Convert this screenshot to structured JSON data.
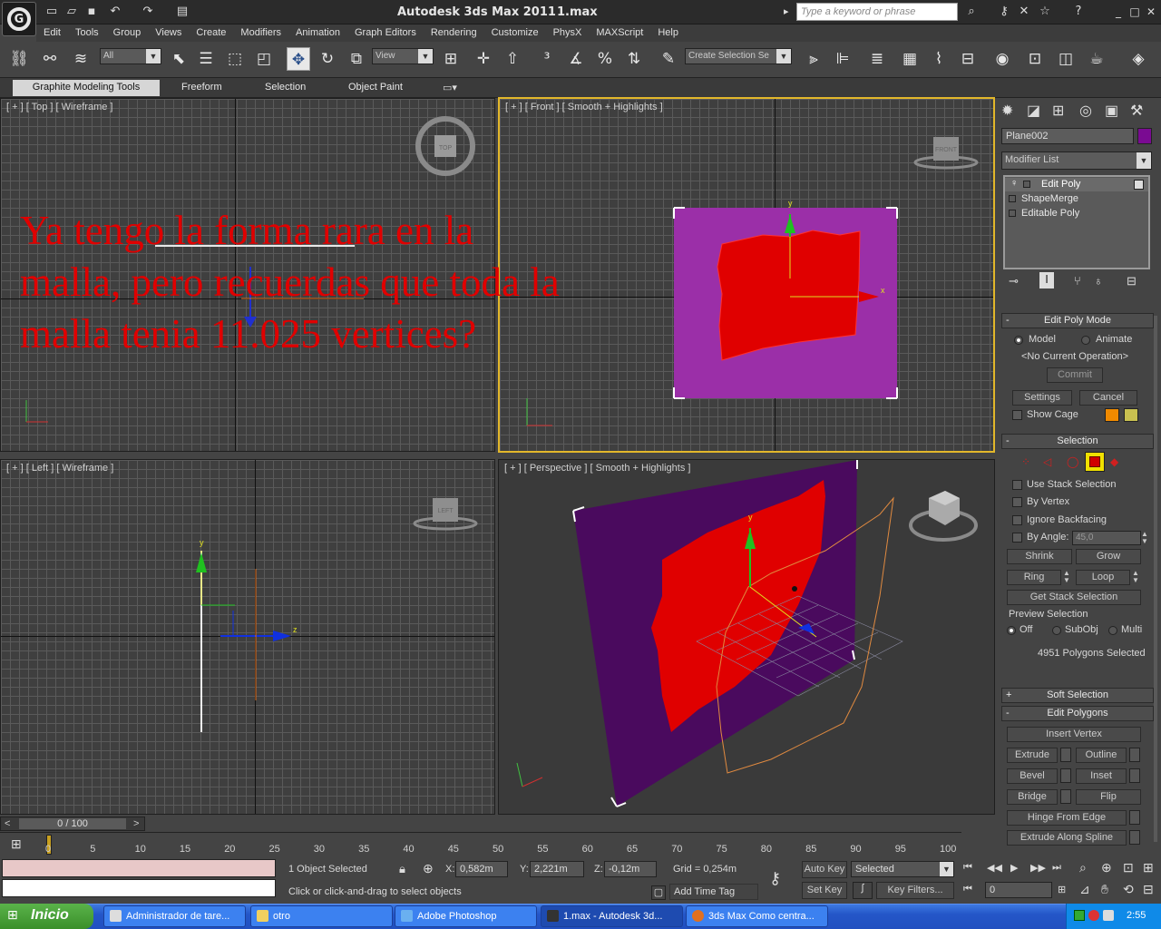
{
  "title_bar": {
    "app_title": "Autodesk 3ds Max  2011",
    "file_name": "1.max",
    "search_placeholder": "Type a keyword or phrase"
  },
  "menu": [
    "Edit",
    "Tools",
    "Group",
    "Views",
    "Create",
    "Modifiers",
    "Animation",
    "Graph Editors",
    "Rendering",
    "Customize",
    "PhysX",
    "MAXScript",
    "Help"
  ],
  "toolbar": {
    "selection_filter": "All",
    "ref_coord": "View",
    "named_selection": "Create Selection Se"
  },
  "ribbon": {
    "tabs": [
      "Graphite Modeling Tools",
      "Freeform",
      "Selection",
      "Object Paint"
    ]
  },
  "viewports": {
    "top": "[ + ] [ Top ] [ Wireframe ]",
    "front": "[ + ] [ Front ] [ Smooth + Highlights ]",
    "left": "[ + ] [ Left ] [ Wireframe ]",
    "perspective": "[ + ] [ Perspective ] [ Smooth + Highlights ]",
    "cube_top": "TOP",
    "cube_front": "FRONT",
    "cube_left": "LEFT"
  },
  "overlay_text": "Ya tengo la forma rara en la malla, pero recuerdas que toda la malla tenia 11.025 vertices?",
  "command_panel": {
    "object_name": "Plane002",
    "object_color": "#7a0b92",
    "modifier_list": "Modifier List",
    "stack": [
      "Edit Poly",
      "ShapeMerge",
      "Editable Poly"
    ],
    "edit_poly_mode": {
      "header": "Edit Poly Mode",
      "model": "Model",
      "animate": "Animate",
      "operation": "<No Current Operation>",
      "commit": "Commit",
      "settings": "Settings",
      "cancel": "Cancel",
      "show_cage": "Show Cage",
      "cage_color1": "#f08a00",
      "cage_color2": "#c8c050"
    },
    "selection": {
      "header": "Selection",
      "use_stack": "Use Stack Selection",
      "by_vertex": "By Vertex",
      "ignore_backfacing": "Ignore Backfacing",
      "by_angle": "By Angle:",
      "angle_value": "45,0",
      "shrink": "Shrink",
      "grow": "Grow",
      "ring": "Ring",
      "loop": "Loop",
      "get_stack": "Get Stack Selection",
      "preview": "Preview Selection",
      "off": "Off",
      "subobj": "SubObj",
      "multi": "Multi",
      "count": "4951 Polygons Selected"
    },
    "soft_selection": "Soft Selection",
    "edit_polygons": {
      "header": "Edit Polygons",
      "insert_vertex": "Insert Vertex",
      "extrude": "Extrude",
      "outline": "Outline",
      "bevel": "Bevel",
      "inset": "Inset",
      "bridge": "Bridge",
      "flip": "Flip",
      "hinge": "Hinge From Edge",
      "extrude_spline": "Extrude Along Spline"
    }
  },
  "timeline": {
    "frame": "0 / 100",
    "ticks": [
      "0",
      "5",
      "10",
      "15",
      "20",
      "25",
      "30",
      "35",
      "40",
      "45",
      "50",
      "55",
      "60",
      "65",
      "70",
      "75",
      "80",
      "85",
      "90",
      "95",
      "100"
    ]
  },
  "status": {
    "objects_selected": "1 Object Selected",
    "prompt": "Click or click-and-drag to select objects",
    "x_label": "X:",
    "x": "0,582m",
    "y_label": "Y:",
    "y": "2,221m",
    "z_label": "Z:",
    "z": "-0,12m",
    "grid": "Grid = 0,254m",
    "add_time_tag": "Add Time Tag",
    "auto_key": "Auto Key",
    "set_key": "Set Key",
    "selected": "Selected",
    "key_filters": "Key Filters...",
    "frame_value": "0"
  },
  "taskbar": {
    "start": "Inicio",
    "tasks": [
      "Administrador de tare...",
      "otro",
      "Adobe Photoshop",
      "1.max - Autodesk 3d...",
      "3ds Max Como centra..."
    ],
    "clock": "2:55"
  }
}
